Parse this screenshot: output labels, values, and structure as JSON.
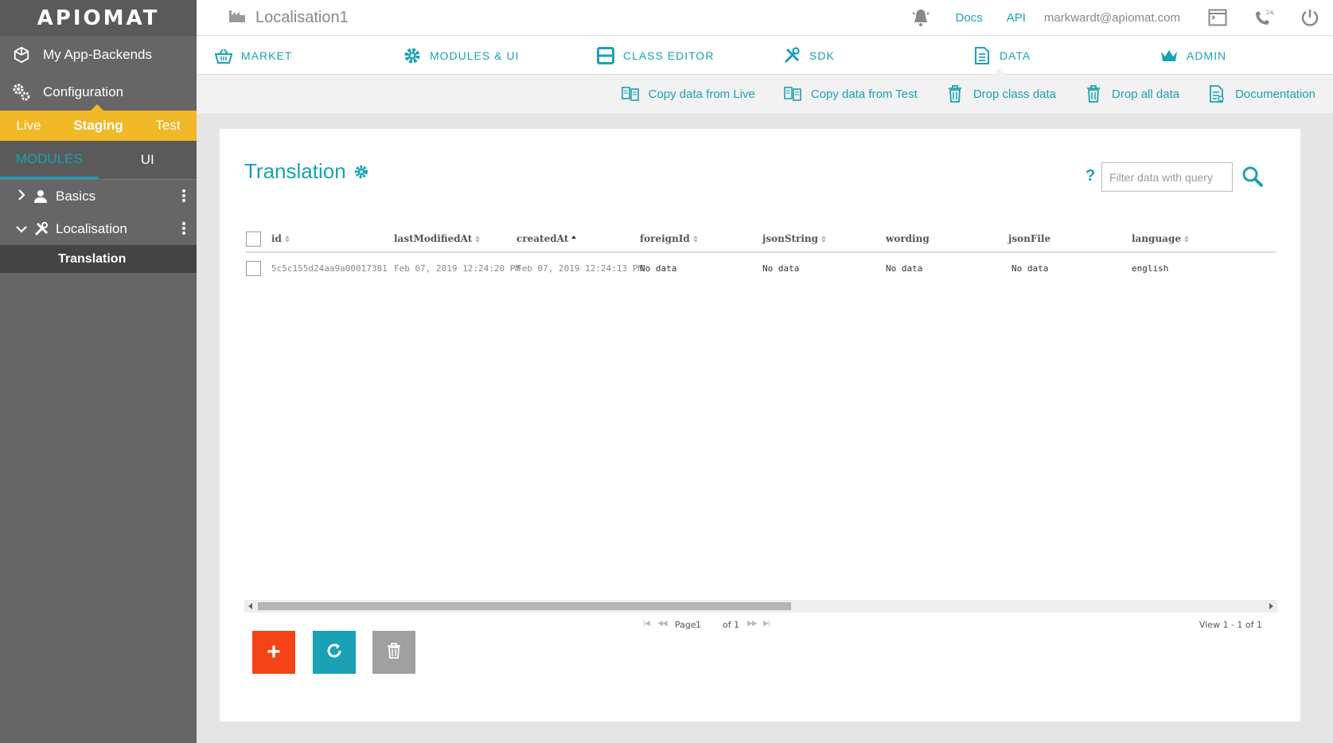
{
  "brand": {
    "logo_text": "APIOMAT"
  },
  "sidebar": {
    "nav": [
      {
        "label": "My App-Backends",
        "icon": "cube-icon"
      },
      {
        "label": "Configuration",
        "icon": "gears-icon"
      }
    ],
    "stages": [
      "Live",
      "Staging",
      "Test"
    ],
    "active_stage": "Staging",
    "mod_tabs": [
      "MODULES",
      "UI"
    ],
    "active_mod_tab": "MODULES",
    "tree": [
      {
        "label": "Basics",
        "icon": "user-icon",
        "expanded": false
      },
      {
        "label": "Localisation",
        "icon": "tools-icon",
        "expanded": true
      }
    ],
    "selected_class": "Translation"
  },
  "topbar": {
    "app_name": "Localisation1",
    "links": [
      "Docs",
      "API"
    ],
    "user_email": "markwardt@apiomat.com",
    "icons": [
      "bell-icon",
      "terminal-icon",
      "support-247-icon",
      "power-icon"
    ]
  },
  "mainnav": {
    "items": [
      {
        "label": "MARKET",
        "icon": "basket-icon"
      },
      {
        "label": "MODULES & UI",
        "icon": "gear-icon"
      },
      {
        "label": "CLASS EDITOR",
        "icon": "window-icon"
      },
      {
        "label": "SDK",
        "icon": "tools-icon"
      },
      {
        "label": "DATA",
        "icon": "document-icon"
      },
      {
        "label": "ADMIN",
        "icon": "crown-icon"
      }
    ],
    "active": "DATA"
  },
  "actions": [
    {
      "label": "Copy data from Live",
      "icon": "copy-data-icon"
    },
    {
      "label": "Copy data from Test",
      "icon": "copy-data-icon"
    },
    {
      "label": "Drop class data",
      "icon": "trash-icon"
    },
    {
      "label": "Drop all data",
      "icon": "trash-icon"
    },
    {
      "label": "Documentation",
      "icon": "documentation-icon"
    }
  ],
  "card": {
    "title": "Translation",
    "help": "?",
    "filter_placeholder": "Filter data with query"
  },
  "table": {
    "columns": [
      {
        "key": "id",
        "label": "id",
        "sortable": true
      },
      {
        "key": "lastModifiedAt",
        "label": "lastModifiedAt",
        "sortable": true
      },
      {
        "key": "createdAt",
        "label": "createdAt",
        "sortable": true,
        "sorted": "asc"
      },
      {
        "key": "foreignId",
        "label": "foreignId",
        "sortable": true
      },
      {
        "key": "jsonString",
        "label": "jsonString",
        "sortable": true
      },
      {
        "key": "wording",
        "label": "wording",
        "sortable": false
      },
      {
        "key": "jsonFile",
        "label": "jsonFile",
        "sortable": false
      },
      {
        "key": "language",
        "label": "language",
        "sortable": true
      }
    ],
    "rows": [
      [
        "5c5c155d24aa9a00017381",
        "Feb 07, 2019 12:24:20 PM",
        "Feb 07, 2019 12:24:13 PM",
        "No data",
        "No data",
        "No data",
        "No data",
        "english"
      ]
    ]
  },
  "pager": {
    "page_label": "Page",
    "page_value": "1",
    "of_label": "of 1",
    "view_info": "View 1 - 1 of 1",
    "first": "|◀",
    "prev": "◀◀",
    "next": "▶▶",
    "last": "▶|"
  },
  "buttons": {
    "add": "+",
    "refresh": "refresh-icon",
    "delete": "trash-icon"
  },
  "colors": {
    "accent": "#1aa1b5",
    "stage_bar": "#f1b827",
    "add_button": "#f44316",
    "sidebar_bg": "#666666"
  }
}
